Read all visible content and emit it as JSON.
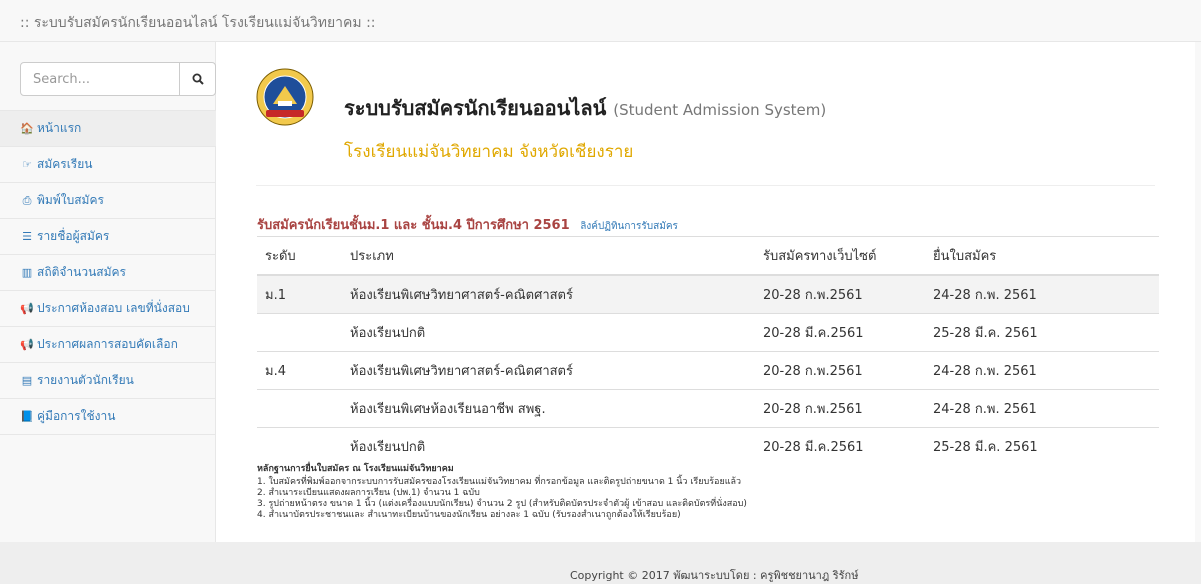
{
  "topbar": {
    "brand": ":: ระบบรับสมัครนักเรียนออนไลน์ โรงเรียนแม่จันวิทยาคม ::"
  },
  "search": {
    "placeholder": "Search...",
    "icon": "search-icon"
  },
  "sidebar": {
    "items": [
      {
        "icon": "home-icon",
        "glyph": "🏠",
        "label": "หน้าแรก"
      },
      {
        "icon": "hand-point-icon",
        "glyph": "☞",
        "label": "สมัครเรียน"
      },
      {
        "icon": "print-icon",
        "glyph": "⎙",
        "label": "พิมพ์ใบสมัคร"
      },
      {
        "icon": "list-icon",
        "glyph": "☰",
        "label": "รายชื่อผู้สมัคร"
      },
      {
        "icon": "bar-chart-icon",
        "glyph": "▥",
        "label": "สถิติจำนวนสมัคร"
      },
      {
        "icon": "bullhorn-icon",
        "glyph": "📢",
        "label": "ประกาศห้องสอบ เลขที่นั่งสอบ"
      },
      {
        "icon": "bullhorn-icon",
        "glyph": "📢",
        "label": "ประกาศผลการสอบคัดเลือก"
      },
      {
        "icon": "file-icon",
        "glyph": "▤",
        "label": "รายงานตัวนักเรียน"
      },
      {
        "icon": "book-icon",
        "glyph": "📘",
        "label": "คู่มือการใช้งาน"
      }
    ]
  },
  "header": {
    "title": "ระบบรับสมัครนักเรียนออนไลน์",
    "title_en": "(Student Admission System)",
    "school": "โรงเรียนแม่จันวิทยาคม จังหวัดเชียงราย"
  },
  "notice": {
    "text": "รับสมัครนักเรียนชั้นม.1 และ ชั้นม.4 ปีการศึกษา 2561",
    "link": "ลิงค์ปฏิทินการรับสมัคร"
  },
  "table": {
    "headers": [
      "ระดับ",
      "ประเภท",
      "รับสมัครทางเว็บไซต์",
      "ยื่นใบสมัคร"
    ],
    "rows": [
      [
        "ม.1",
        "ห้องเรียนพิเศษวิทยาศาสตร์-คณิตศาสตร์",
        "20-28 ก.พ.2561",
        "24-28 ก.พ. 2561"
      ],
      [
        "",
        "ห้องเรียนปกติ",
        "20-28 มี.ค.2561",
        "25-28 มี.ค. 2561"
      ],
      [
        "ม.4",
        "ห้องเรียนพิเศษวิทยาศาสตร์-คณิตศาสตร์",
        "20-28 ก.พ.2561",
        "24-28 ก.พ. 2561"
      ],
      [
        "",
        "ห้องเรียนพิเศษห้องเรียนอาชีพ สพฐ.",
        "20-28 ก.พ.2561",
        "24-28 ก.พ. 2561"
      ],
      [
        "",
        "ห้องเรียนปกติ",
        "20-28 มี.ค.2561",
        "25-28 มี.ค. 2561"
      ]
    ]
  },
  "docs": {
    "heading": "หลักฐานการยื่นใบสมัคร ณ โรงเรียนแม่จันวิทยาคม",
    "items": [
      "1. ใบสมัครที่พิมพ์ออกจากระบบการรับสมัครของโรงเรียนแม่จันวิทยาคม ที่กรอกข้อมูล และติดรูปถ่ายขนาด 1 นิ้ว เรียบร้อยแล้ว",
      "2. สำเนาระเบียนแสดงผลการเรียน (ปพ.1) จำนวน 1 ฉบับ",
      "3. รูปถ่ายหน้าตรง ขนาด 1 นิ้ว (แต่งเครื่องแบบนักเรียน) จำนวน 2 รูป (สำหรับติดบัตรประจำตัวผู้ เข้าสอบ และติดบัตรที่นั่งสอบ)",
      "4. สำเนาบัตรประชาชนและ สำเนาทะเบียนบ้านของนักเรียน อย่างละ 1 ฉบับ (รับรองสำเนาถูกต้องให้เรียบร้อย)"
    ]
  },
  "footer": {
    "copyright": "Copyright © 2017 พัฒนาระบบโดย : ครูพิชชยานาฎ ริรักษ์"
  },
  "colors": {
    "link": "#337ab7",
    "school": "#e0a800",
    "notice": "#a94442"
  }
}
